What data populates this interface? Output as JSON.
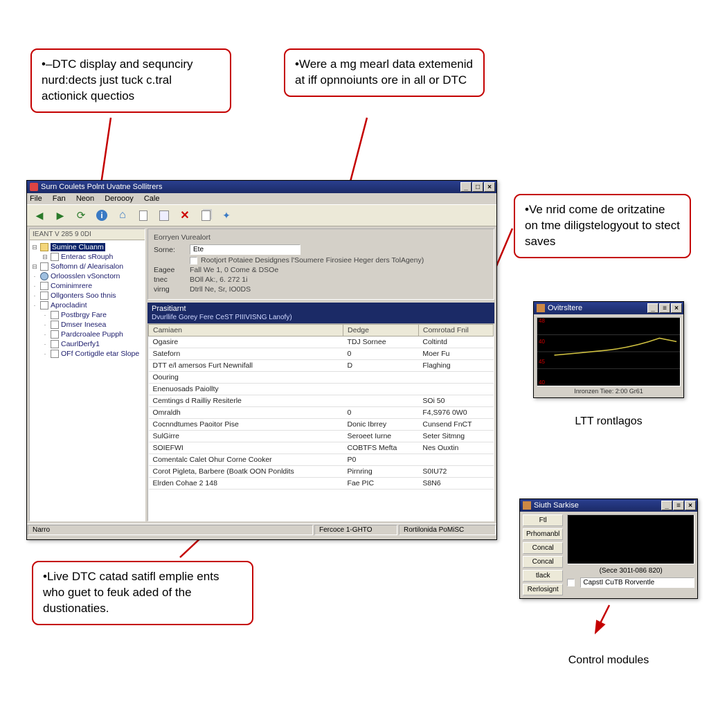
{
  "callouts": {
    "c1": "•–DTC display and sequnciry nurd:dects just tuck c.tral actionick quectios",
    "c2": "•Were a mg mearl data extemenid at iff opnnoiunts ore in all or DTC",
    "c3": "•Ve nrid come de oritzatine on tme diligstelogyout to stect saves",
    "c4": "•Live DTC catad satifl emplie ents who guet to feuk aded of the dustionaties."
  },
  "main": {
    "title": "Surn Coulets Polnt Uvatne Sollitrers",
    "menu": [
      "File",
      "Fan",
      "Neon",
      "Deroooy",
      "Cale"
    ],
    "tree_tab": "IEANT V 285 9 0DI",
    "tree": [
      {
        "label": "Sumine Cluanm",
        "sel": true,
        "icon": "folder"
      },
      {
        "label": "Enterac sRouph",
        "icon": "page",
        "child": true
      },
      {
        "label": "Softomn d/ Alearisalon",
        "icon": "page"
      },
      {
        "label": "Orloosslen vSonctorn",
        "icon": "gear"
      },
      {
        "label": "Cominimrere",
        "icon": "page"
      },
      {
        "label": "Ollgonters Soo thnis",
        "icon": "page"
      },
      {
        "label": "Aprocladint",
        "icon": "page"
      },
      {
        "label": "Postbrgy Fare",
        "icon": "page",
        "child": true
      },
      {
        "label": "Dmser Inesea",
        "icon": "page",
        "child": true
      },
      {
        "label": "Pardcroalee Pupph",
        "icon": "page",
        "child": true
      },
      {
        "label": "CaurlDerfy1",
        "icon": "page",
        "child": true
      },
      {
        "label": "OFf Cortigdle etar Slope",
        "icon": "page",
        "child": true
      }
    ],
    "detail": {
      "group": "Eorryen Vurealort",
      "rows": [
        {
          "lbl": "Sorne:",
          "val": "Ete"
        },
        {
          "lbl": "",
          "chk": true,
          "val": "Rootjort  Potaiee Desidgnes l'Soumere Firosiee Heger ders TolAgeny)"
        },
        {
          "lbl": "Eagee",
          "val": "Fall We 1, 0 Come & DSOe"
        },
        {
          "lbl": "tnec",
          "val": "BOll Ak:, 6. 272 1i"
        },
        {
          "lbl": "virng",
          "val": "Dtrll Ne, Sr, IO0DS"
        }
      ]
    },
    "section": {
      "title": "Prasitiarnt",
      "sub": "Dvurllife Gorey Fere CeST PIIIVISNG Lanofy)"
    },
    "table": {
      "cols": [
        "Camiaen",
        "Dedge",
        "Comrotad Fnil"
      ],
      "rows": [
        [
          "Ogasire",
          "TDJ Sornee",
          "Coltintd"
        ],
        [
          "Sateforn",
          "0",
          "Moer Fu"
        ],
        [
          "DTT e/l amersos Furt Newnifall",
          "D",
          "Flaghing"
        ],
        [
          "Oouring",
          "",
          ""
        ],
        [
          "Enenuosads Paiollty",
          "",
          ""
        ],
        [
          "Cemtings d Railliy Resiterle",
          "",
          "SOi 50"
        ],
        [
          "Omraldh",
          "0",
          "F4,S976 0W0"
        ],
        [
          "Cocnndtumes Paoitor Pise",
          "Donic Ibrrey",
          "Cunsend FnCT"
        ],
        [
          "SulGirre",
          "Seroeet Iurne",
          "Seter Sitmng"
        ],
        [
          "SOIEFWI",
          "COBTFS Mefta",
          "Nes Ouxtin"
        ],
        [
          "Comentalc Calet Ohur Corne Cooker",
          "P0",
          ""
        ],
        [
          "Corot Pigleta, Barbere (Boatk OON Ponldits",
          "Pirnring",
          "S0IU72"
        ],
        [
          "Elrden Cohae 2 148",
          "Fae PIC",
          "S8N6"
        ]
      ]
    },
    "status": {
      "left": "Narro",
      "mid": "Fercoce 1-GHTO",
      "right": "Rortilonida PoMiSC"
    }
  },
  "scope_win": {
    "title": "Ovitrsltere",
    "yticks": [
      "48",
      "40",
      "45",
      "40"
    ],
    "footer": "Inronzen Tiee: 2:00 Gr61",
    "caption": "LTT rontlagos"
  },
  "ctrl_win": {
    "title": "Siuth Sarkise",
    "buttons": [
      "Ftl",
      "Prhomanbl",
      "Concal",
      "Concal",
      "tlack",
      "Rerlosignt"
    ],
    "opt_label": "(Sece 301t-086 820)",
    "input_val": "CapstI CuTB Rorventle",
    "caption": "Control modules"
  },
  "icons": {
    "arrow_left": "◀",
    "arrow_right": "▶",
    "refresh": "🔄",
    "info": "ℹ",
    "home": "⌂",
    "page": "📄",
    "pages": "📑",
    "delete": "✖",
    "copy": "📋",
    "tool": "🔧"
  }
}
